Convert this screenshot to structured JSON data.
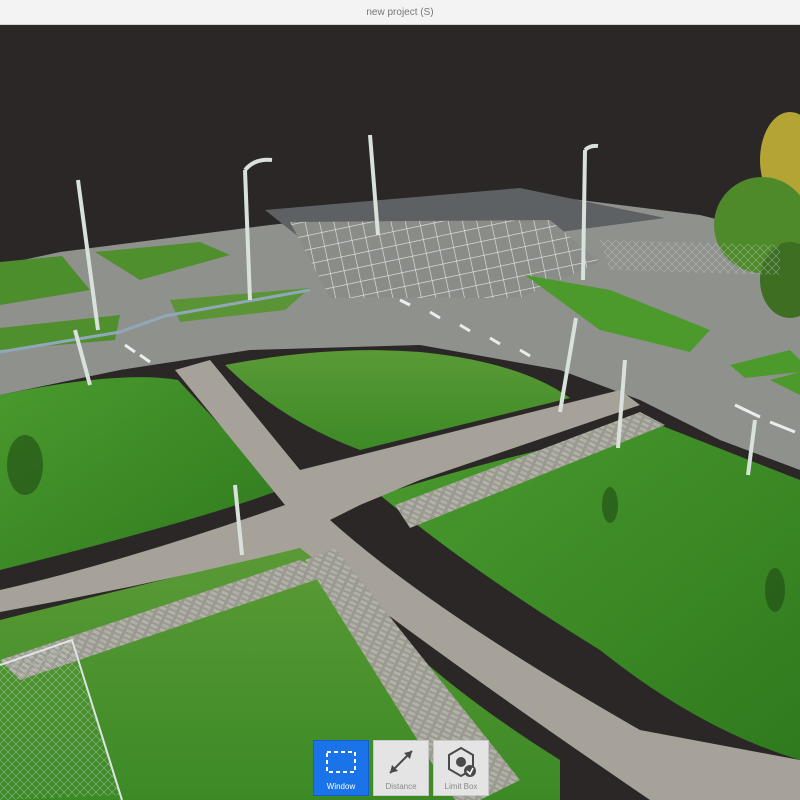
{
  "window": {
    "title": "new project (S)"
  },
  "viewport": {
    "content": "3D point cloud view of a road intersection with grass areas, paths and street lamps"
  },
  "toolbar": {
    "active_tool": "Window",
    "tools": [
      {
        "label": "Window",
        "icon": "selection-window-icon"
      },
      {
        "label": "Distance",
        "icon": "distance-measure-icon"
      },
      {
        "label": "Limit Box",
        "icon": "limit-box-icon"
      }
    ]
  },
  "colors": {
    "background": "#2a2726",
    "grass": "#3e8a2a",
    "asphalt": "#8f918c",
    "path": "#a29e94",
    "accent": "#1a73e8"
  }
}
